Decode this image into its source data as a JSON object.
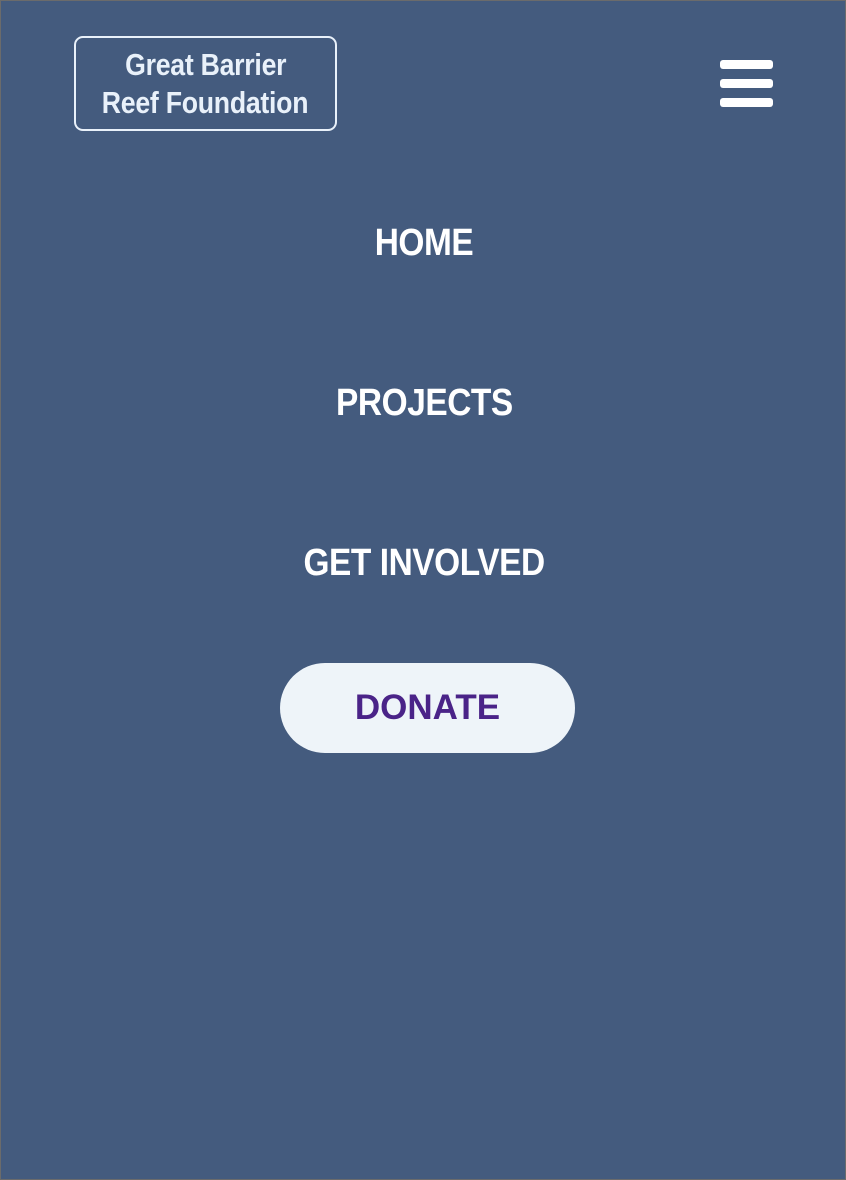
{
  "header": {
    "logo": {
      "line1": "Great Barrier",
      "line2": "Reef Foundation"
    },
    "menu_icon": "hamburger-menu-icon"
  },
  "nav": {
    "items": [
      {
        "label": "HOME"
      },
      {
        "label": "PROJECTS"
      },
      {
        "label": "GET INVOLVED"
      }
    ],
    "donate_label": "DONATE"
  },
  "colors": {
    "background": "#445b7e",
    "logo_text": "#e9f1fa",
    "nav_text": "#ffffff",
    "donate_background": "#eef4f9",
    "donate_text": "#4a2388"
  }
}
